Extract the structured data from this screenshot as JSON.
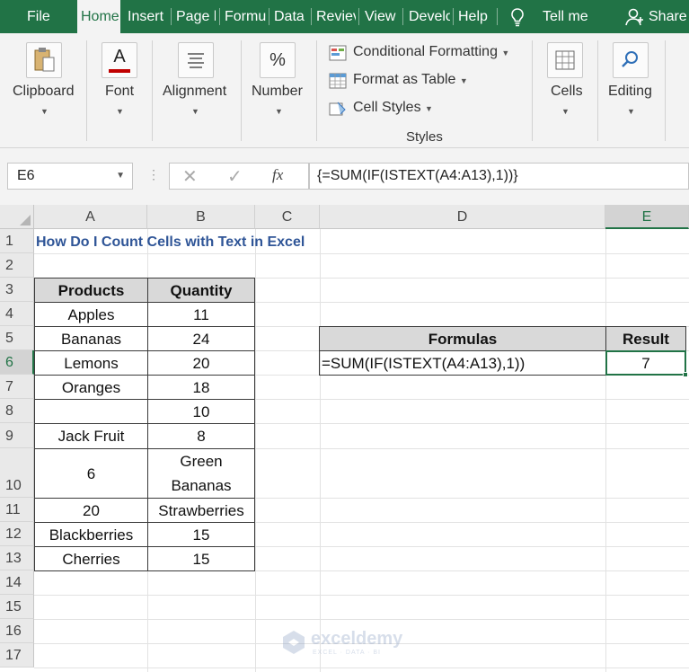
{
  "tabs": [
    {
      "label": "File",
      "active": false
    },
    {
      "label": "Home",
      "active": true
    },
    {
      "label": "Insert",
      "active": false
    },
    {
      "label": "Page l",
      "active": false
    },
    {
      "label": "Formu",
      "active": false
    },
    {
      "label": "Data",
      "active": false
    },
    {
      "label": "Reviev",
      "active": false
    },
    {
      "label": "View",
      "active": false
    },
    {
      "label": "Develo",
      "active": false
    },
    {
      "label": "Help",
      "active": false
    }
  ],
  "tell_me": "Tell me",
  "share": "Share",
  "ribbon": {
    "clipboard": "Clipboard",
    "font": "Font",
    "alignment": "Alignment",
    "number": "Number",
    "number_symbol": "%",
    "font_symbol": "A",
    "conditional_formatting": "Conditional Formatting",
    "format_as_table": "Format as Table",
    "cell_styles": "Cell Styles",
    "styles_group": "Styles",
    "cells": "Cells",
    "editing": "Editing"
  },
  "formula_bar": {
    "name_box": "E6",
    "fx": "fx",
    "formula": "{=SUM(IF(ISTEXT(A4:A13),1))}"
  },
  "columns": [
    "A",
    "B",
    "C",
    "D",
    "E"
  ],
  "rows": [
    "1",
    "2",
    "3",
    "4",
    "5",
    "6",
    "7",
    "8",
    "9",
    "10",
    "11",
    "12",
    "13",
    "14",
    "15",
    "16",
    "17"
  ],
  "sheet": {
    "title": "How Do I Count Cells with Text in Excel",
    "table_headers": [
      "Products",
      "Quantity"
    ],
    "table_rows": [
      [
        "Apples",
        "11"
      ],
      [
        "Bananas",
        "24"
      ],
      [
        "Lemons",
        "20"
      ],
      [
        "Oranges",
        "18"
      ],
      [
        "",
        "10"
      ],
      [
        "Jack Fruit",
        "8"
      ],
      [
        "6",
        "Green Bananas"
      ],
      [
        "20",
        "Strawberries"
      ],
      [
        "Blackberries",
        "15"
      ],
      [
        "Cherries",
        "15"
      ]
    ],
    "formulas_header": "Formulas",
    "result_header": "Result",
    "formula_text": "=SUM(IF(ISTEXT(A4:A13),1))",
    "result_value": "7"
  },
  "watermark": {
    "name": "exceldemy",
    "tagline": "EXCEL · DATA · BI"
  },
  "colors": {
    "accent": "#217346",
    "title": "#2f5597",
    "header_fill": "#d9d9d9"
  }
}
